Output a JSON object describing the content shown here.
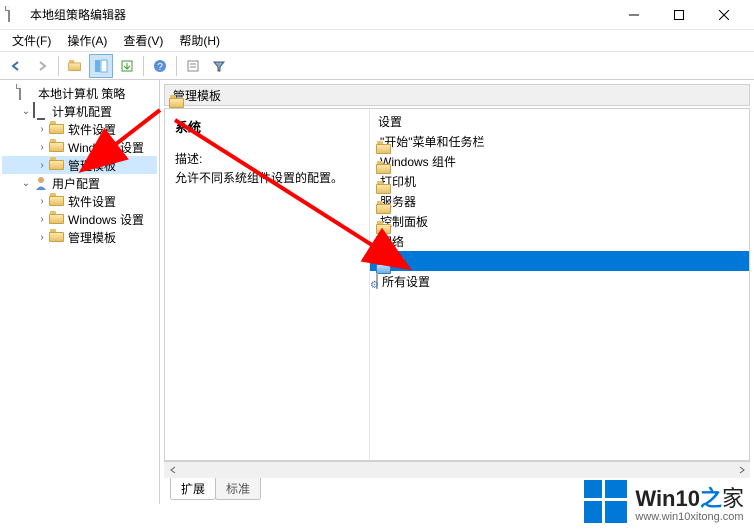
{
  "window": {
    "title": "本地组策略编辑器"
  },
  "menu": {
    "file": "文件(F)",
    "action": "操作(A)",
    "view": "查看(V)",
    "help": "帮助(H)"
  },
  "tree": {
    "root": "本地计算机 策略",
    "computer_config": "计算机配置",
    "cc_software": "软件设置",
    "cc_windows": "Windows 设置",
    "cc_admin": "管理模板",
    "user_config": "用户配置",
    "uc_software": "软件设置",
    "uc_windows": "Windows 设置",
    "uc_admin": "管理模板"
  },
  "path": {
    "label": "管理模板"
  },
  "detail": {
    "heading": "系统",
    "desc_label": "描述:",
    "desc_text": "允许不同系统组件设置的配置。"
  },
  "list": {
    "header": "设置",
    "items": [
      {
        "name": "\"开始\"菜单和任务栏",
        "type": "folder"
      },
      {
        "name": "Windows 组件",
        "type": "folder"
      },
      {
        "name": "打印机",
        "type": "folder"
      },
      {
        "name": "服务器",
        "type": "folder"
      },
      {
        "name": "控制面板",
        "type": "folder"
      },
      {
        "name": "网络",
        "type": "folder"
      },
      {
        "name": "系统",
        "type": "folder",
        "selected": true
      },
      {
        "name": "所有设置",
        "type": "settings"
      }
    ]
  },
  "tabs": {
    "extended": "扩展",
    "standard": "标准"
  },
  "watermark": {
    "brand_main": "Win10",
    "brand_zhi": "之",
    "brand_suffix": "家",
    "url": "www.win10xitong.com"
  }
}
